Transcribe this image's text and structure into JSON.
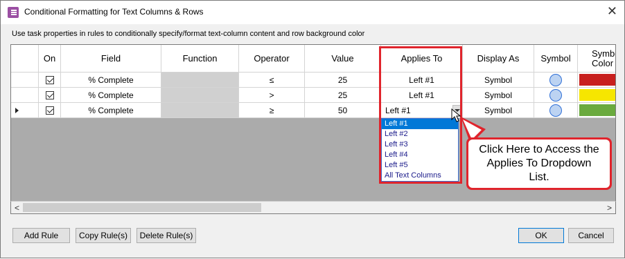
{
  "window": {
    "title": "Conditional Formatting for Text Columns & Rows",
    "close_glyph": "✕"
  },
  "description": "Use task properties in rules to conditionally specify/format text-column content and row background color",
  "grid": {
    "columns": [
      "On",
      "Field",
      "Function",
      "Operator",
      "Value",
      "Applies To",
      "Display As",
      "Symbol",
      "Symbol Color"
    ],
    "rows": [
      {
        "on": true,
        "field": "% Complete",
        "function": "",
        "operator": "≤",
        "value": "25",
        "applies_to": "Left #1",
        "display_as": "Symbol",
        "symbol": "circle",
        "color": "#c8201e"
      },
      {
        "on": true,
        "field": "% Complete",
        "function": "",
        "operator": ">",
        "value": "25",
        "applies_to": "Left #1",
        "display_as": "Symbol",
        "symbol": "circle",
        "color": "#f6e600"
      },
      {
        "on": true,
        "field": "% Complete",
        "function": "",
        "operator": "≥",
        "value": "50",
        "applies_to": "Left #1",
        "display_as": "Symbol",
        "symbol": "circle",
        "color": "#6aaa3e"
      }
    ],
    "current_row": 2
  },
  "dropdown": {
    "options": [
      "Left #1",
      "Left #2",
      "Left #3",
      "Left #4",
      "Left #5",
      "All Text Columns"
    ],
    "selected": "Left #1"
  },
  "callout": {
    "text": "Click Here to Access the Applies To Dropdown List."
  },
  "scrollbar": {
    "left_arrow": "<",
    "right_arrow": ">"
  },
  "buttons": {
    "add_rule": "Add Rule",
    "copy_rules": "Copy Rule(s)",
    "delete_rules": "Delete Rule(s)",
    "ok": "OK",
    "cancel": "Cancel"
  },
  "colors": {
    "highlight_red": "#e0242c",
    "selection_blue": "#0078d7",
    "symbol_fill": "#bcd3f2",
    "symbol_border": "#2f6fd6"
  }
}
